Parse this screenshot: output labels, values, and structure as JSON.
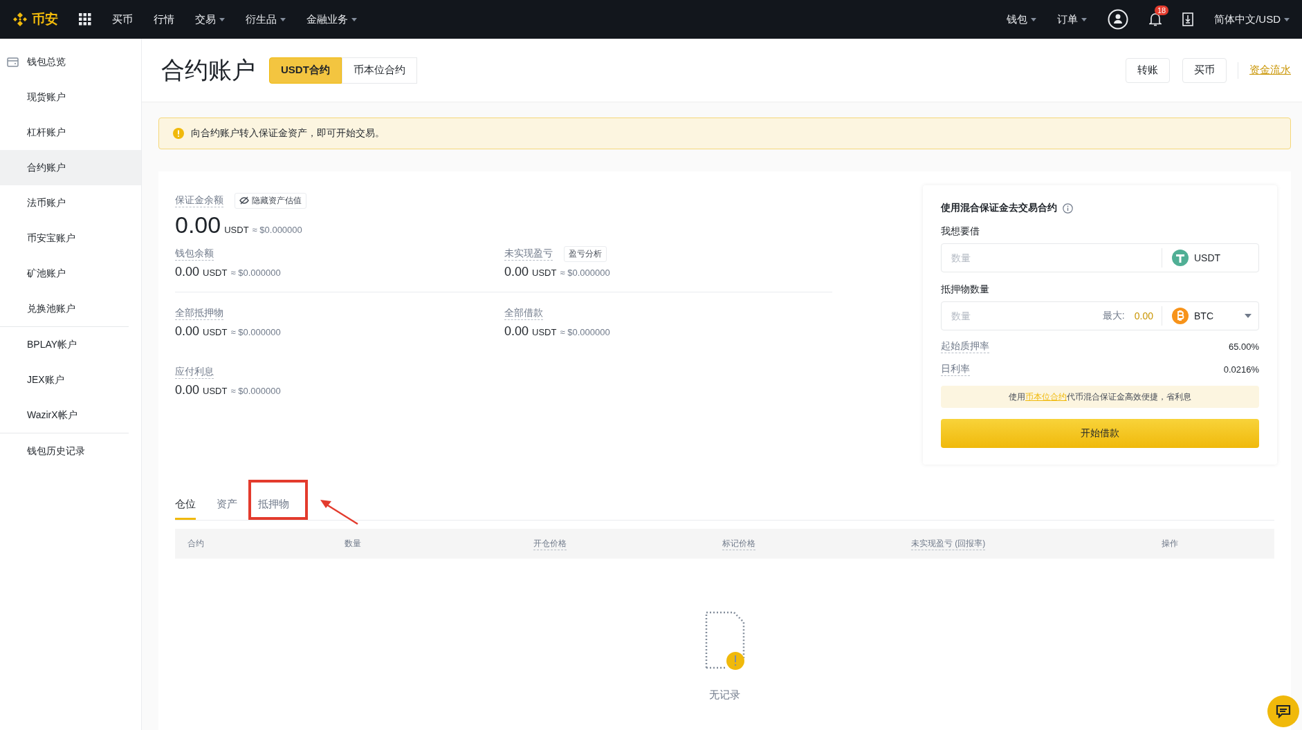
{
  "nav": {
    "logo": "币安",
    "items": [
      {
        "label": "买币",
        "dropdown": false
      },
      {
        "label": "行情",
        "dropdown": false
      },
      {
        "label": "交易",
        "dropdown": true
      },
      {
        "label": "衍生品",
        "dropdown": true
      },
      {
        "label": "金融业务",
        "dropdown": true
      }
    ],
    "right_menus": [
      {
        "label": "钱包",
        "dropdown": true
      },
      {
        "label": "订单",
        "dropdown": true
      }
    ],
    "notification_count": "18",
    "language": "简体中文/USD"
  },
  "sidebar": {
    "sections": [
      {
        "items": [
          {
            "label": "钱包总览",
            "selected": false,
            "kind": "overview"
          },
          {
            "label": "现货账户",
            "selected": false,
            "kind": "account"
          },
          {
            "label": "杠杆账户",
            "selected": false,
            "kind": "account"
          },
          {
            "label": "合约账户",
            "selected": true,
            "kind": "account"
          },
          {
            "label": "法币账户",
            "selected": false,
            "kind": "account"
          },
          {
            "label": "币安宝账户",
            "selected": false,
            "kind": "account"
          },
          {
            "label": "矿池账户",
            "selected": false,
            "kind": "account"
          },
          {
            "label": "兑换池账户",
            "selected": false,
            "kind": "account"
          }
        ]
      },
      {
        "items": [
          {
            "label": "BPLAY帐户",
            "selected": false,
            "kind": "account"
          },
          {
            "label": "JEX账户",
            "selected": false,
            "kind": "account"
          },
          {
            "label": "WazirX帐户",
            "selected": false,
            "kind": "account"
          }
        ]
      },
      {
        "items": [
          {
            "label": "钱包历史记录",
            "selected": false,
            "kind": "account"
          }
        ]
      }
    ]
  },
  "header": {
    "title": "合约账户",
    "segments": [
      {
        "label": "USDT合约",
        "selected": true
      },
      {
        "label": "币本位合约",
        "selected": false
      }
    ],
    "actions": [
      "转账",
      "买币"
    ],
    "link": "资金流水"
  },
  "alert": {
    "text": "向合约账户转入保证金资产，即可开始交易。"
  },
  "summary": {
    "main": {
      "label": "保证金余额",
      "button": "隐藏资产估值",
      "amount": "0.00",
      "unit": "USDT",
      "approx": "≈ $0.000000"
    },
    "rows": [
      [
        {
          "label": "钱包余额",
          "amount": "0.00",
          "unit": "USDT",
          "approx": "≈ $0.000000"
        },
        {
          "label": "未实现盈亏",
          "button": "盈亏分析",
          "amount": "0.00",
          "unit": "USDT",
          "approx": "≈ $0.000000"
        }
      ],
      [
        {
          "label": "全部抵押物",
          "amount": "0.00",
          "unit": "USDT",
          "approx": "≈ $0.000000"
        },
        {
          "label": "全部借款",
          "amount": "0.00",
          "unit": "USDT",
          "approx": "≈ $0.000000"
        }
      ],
      [
        {
          "label": "应付利息",
          "amount": "0.00",
          "unit": "USDT",
          "approx": "≈ $0.000000"
        }
      ]
    ]
  },
  "borrow": {
    "title": "使用混合保证金去交易合约",
    "borrow_label": "我想要借",
    "borrow_input": {
      "placeholder": "数量",
      "coin": "USDT"
    },
    "collateral_label": "抵押物数量",
    "collateral_input": {
      "placeholder": "数量",
      "max_label": "最大:",
      "max_value": "0.00",
      "coin": "BTC"
    },
    "rates": [
      {
        "label": "起始质押率",
        "value": "65.00%"
      },
      {
        "label": "日利率",
        "value": "0.0216%"
      }
    ],
    "note": {
      "before": "使用",
      "link": "币本位合约",
      "after": "代币混合保证金高效便捷，省利息"
    },
    "button": "开始借款"
  },
  "tabs": [
    {
      "label": "仓位",
      "selected": true,
      "highlighted": false
    },
    {
      "label": "资产",
      "selected": false,
      "highlighted": false
    },
    {
      "label": "抵押物",
      "selected": false,
      "highlighted": true
    }
  ],
  "table": {
    "columns": [
      {
        "label": "合约",
        "underlined": false
      },
      {
        "label": "数量",
        "underlined": false
      },
      {
        "label": "开仓价格",
        "underlined": true
      },
      {
        "label": "标记价格",
        "underlined": true
      },
      {
        "label": "未实现盈亏 (回报率)",
        "underlined": true
      },
      {
        "label": "操作",
        "underlined": false
      }
    ],
    "empty_text": "无记录"
  }
}
